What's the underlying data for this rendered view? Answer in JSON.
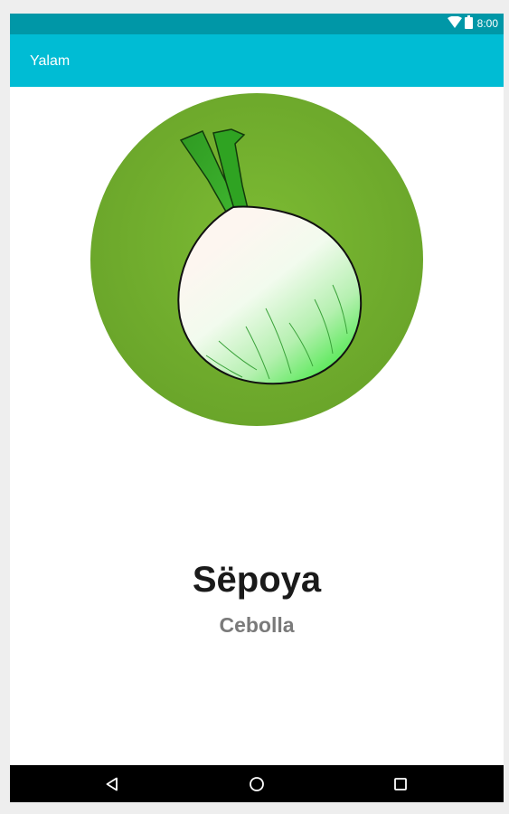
{
  "status_bar": {
    "time": "8:00",
    "icons": [
      "wifi-icon",
      "battery-icon"
    ]
  },
  "app_bar": {
    "title": "Yalam"
  },
  "card": {
    "illustration": "onion-icon",
    "word": "Sëpoya",
    "translation": "Cebolla"
  },
  "nav_bar": {
    "buttons": [
      "back-icon",
      "home-icon",
      "recents-icon"
    ]
  },
  "colors": {
    "status_bar": "#0097a7",
    "app_bar": "#00bcd4",
    "circle_green": "#76b52e",
    "nav_bar": "#000000"
  }
}
